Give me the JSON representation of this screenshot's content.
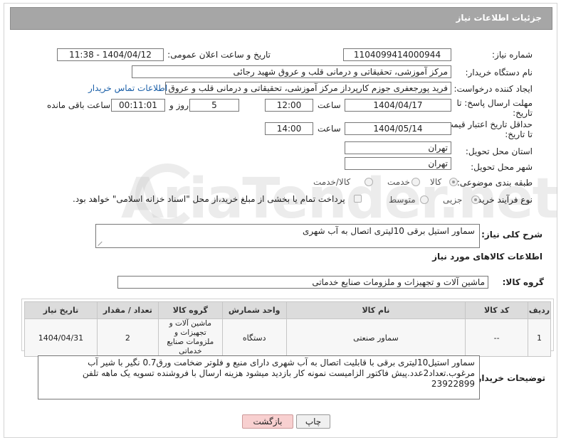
{
  "header": {
    "title": "جزئیات اطلاعات نیاز"
  },
  "form": {
    "need_number_label": "شماره نیاز:",
    "need_number": "1104099414000944",
    "announce_label": "تاریخ و ساعت اعلان عمومی:",
    "announce_value": "1404/04/12 - 11:38",
    "buyer_org_label": "نام دستگاه خریدار:",
    "buyer_org": "مرکز آموزشی، تحقیقاتی و درمانی قلب و عروق شهید رجائی",
    "creator_label": "ایجاد کننده درخواست:",
    "creator": "فرید پورجعفری جوزم کارپرداز  مرکز آموزشی، تحقیقاتی و درمانی قلب و عروق شهید رجائی",
    "contact_link": "اطلاعات تماس خریدار",
    "deadline_label_1": "مهلت ارسال پاسخ: تا",
    "deadline_label_2": "تاریخ:",
    "deadline_date": "1404/04/17",
    "time_label": "ساعت",
    "deadline_time": "12:00",
    "days_value": "5",
    "days_label": "روز و",
    "remaining_value": "00:11:01",
    "remaining_label": "ساعت باقی مانده",
    "validity_label_1": "حداقل تاریخ اعتبار قیمت:",
    "validity_label_2": "تا تاریخ:",
    "validity_date": "1404/05/14",
    "validity_time": "14:00",
    "province_label": "استان محل تحویل:",
    "province": "تهران",
    "city_label": "شهر محل تحویل:",
    "city": "تهران",
    "category_label": "طبقه بندی موضوعی:",
    "category_options": [
      "کالا",
      "خدمت",
      "کالا/خدمت"
    ],
    "category_selected": "کالا",
    "process_label": "نوع فرآیند خرید :",
    "process_options": [
      "جزیی",
      "متوسط"
    ],
    "process_selected": "جزیی",
    "payment_note": "پرداخت تمام یا بخشی از مبلغ خرید،از محل \"اسناد خزانه اسلامی\" خواهد بود."
  },
  "summary": {
    "label": "شرح کلی نیاز:",
    "text": "سماور استیل برقی 10لیتری اتصال به آب شهری"
  },
  "goods_section": {
    "title": "اطلاعات کالاهای مورد نیاز",
    "group_label": "گروه کالا:",
    "group_value": "ماشین آلات و تجهیزات و ملزومات صنایع خدماتی"
  },
  "table": {
    "headers": [
      "ردیف",
      "کد کالا",
      "نام کالا",
      "واحد شمارش",
      "گروه کالا",
      "تعداد / مقدار",
      "تاریخ نیاز"
    ],
    "rows": [
      {
        "row": "1",
        "code": "--",
        "name": "سماور صنعتی",
        "unit": "دستگاه",
        "group": "ماشین آلات و تجهیزات و ملزومات صنایع خدماتی",
        "qty": "2",
        "date": "1404/04/31"
      }
    ]
  },
  "buyer_notes": {
    "label": "توضیحات خریدار:",
    "text": "سماور استیل10لیتری برقی با قابلیت اتصال به آب شهری دارای منبع و فلوتر ضخامت ورق0.7 نگیر با شیر آب مرغوب.تعداد2عدد.پیش فاکتور الزامیست نمونه کار بازدید میشود هزینه ارسال با فروشنده تسویه یک ماهه تلفن 23922899"
  },
  "buttons": {
    "print": "چاپ",
    "back": "بازگشت"
  },
  "watermark": {
    "text": "AriaTender.net"
  }
}
